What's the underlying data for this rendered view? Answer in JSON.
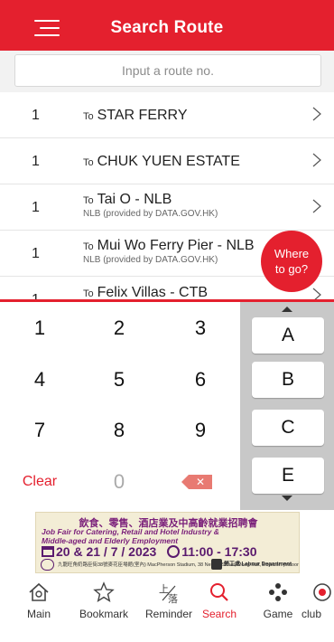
{
  "header": {
    "title": "Search Route"
  },
  "search": {
    "placeholder": "Input a route no."
  },
  "routes": [
    {
      "number": "1",
      "to_label": "To",
      "destination": "STAR FERRY",
      "provider": ""
    },
    {
      "number": "1",
      "to_label": "To",
      "destination": "CHUK YUEN ESTATE",
      "provider": ""
    },
    {
      "number": "1",
      "to_label": "To",
      "destination": "Tai O - NLB",
      "provider": "NLB (provided by DATA.GOV.HK)"
    },
    {
      "number": "1",
      "to_label": "To",
      "destination": "Mui Wo Ferry Pier - NLB",
      "provider": "NLB (provided by DATA.GOV.HK)"
    },
    {
      "number": "1",
      "to_label": "To",
      "destination": "Felix Villas - CTB",
      "provider": ""
    }
  ],
  "where_button": {
    "line1": "Where",
    "line2": "to go?"
  },
  "keypad": {
    "keys": [
      "1",
      "2",
      "3",
      "4",
      "5",
      "6",
      "7",
      "8",
      "9",
      "Clear",
      "0"
    ],
    "backspace_icon": "backspace-icon",
    "letters": [
      "A",
      "B",
      "C",
      "E"
    ]
  },
  "banner": {
    "line1": "飲食、零售、酒店業及中高齡就業招聘會",
    "line2": "Job Fair for Catering, Retail and Hotel Industry &",
    "line3": "Middle-aged and Elderly Employment",
    "date": "20 & 21 / 7 / 2023",
    "time": "11:00 - 17:30",
    "venue": "九龍旺角奶路臣街38號麥花臣場館(室內) MacPherson Stadium, 38 Nelson Street, Mong Kok, Kowloon (Indoor)",
    "dept": "勞工處 Labour Department"
  },
  "tabs": [
    {
      "label": "Main",
      "icon": "home-icon"
    },
    {
      "label": "Bookmark",
      "icon": "star-icon"
    },
    {
      "label": "Reminder",
      "icon": "reminder-icon"
    },
    {
      "label": "Search",
      "icon": "search-icon"
    },
    {
      "label": "Game",
      "icon": "game-icon"
    },
    {
      "label": "club",
      "icon": "club-icon"
    }
  ],
  "colors": {
    "accent": "#e4202e",
    "keypad_side": "#c8c8c8",
    "backspace": "#e87a72"
  }
}
